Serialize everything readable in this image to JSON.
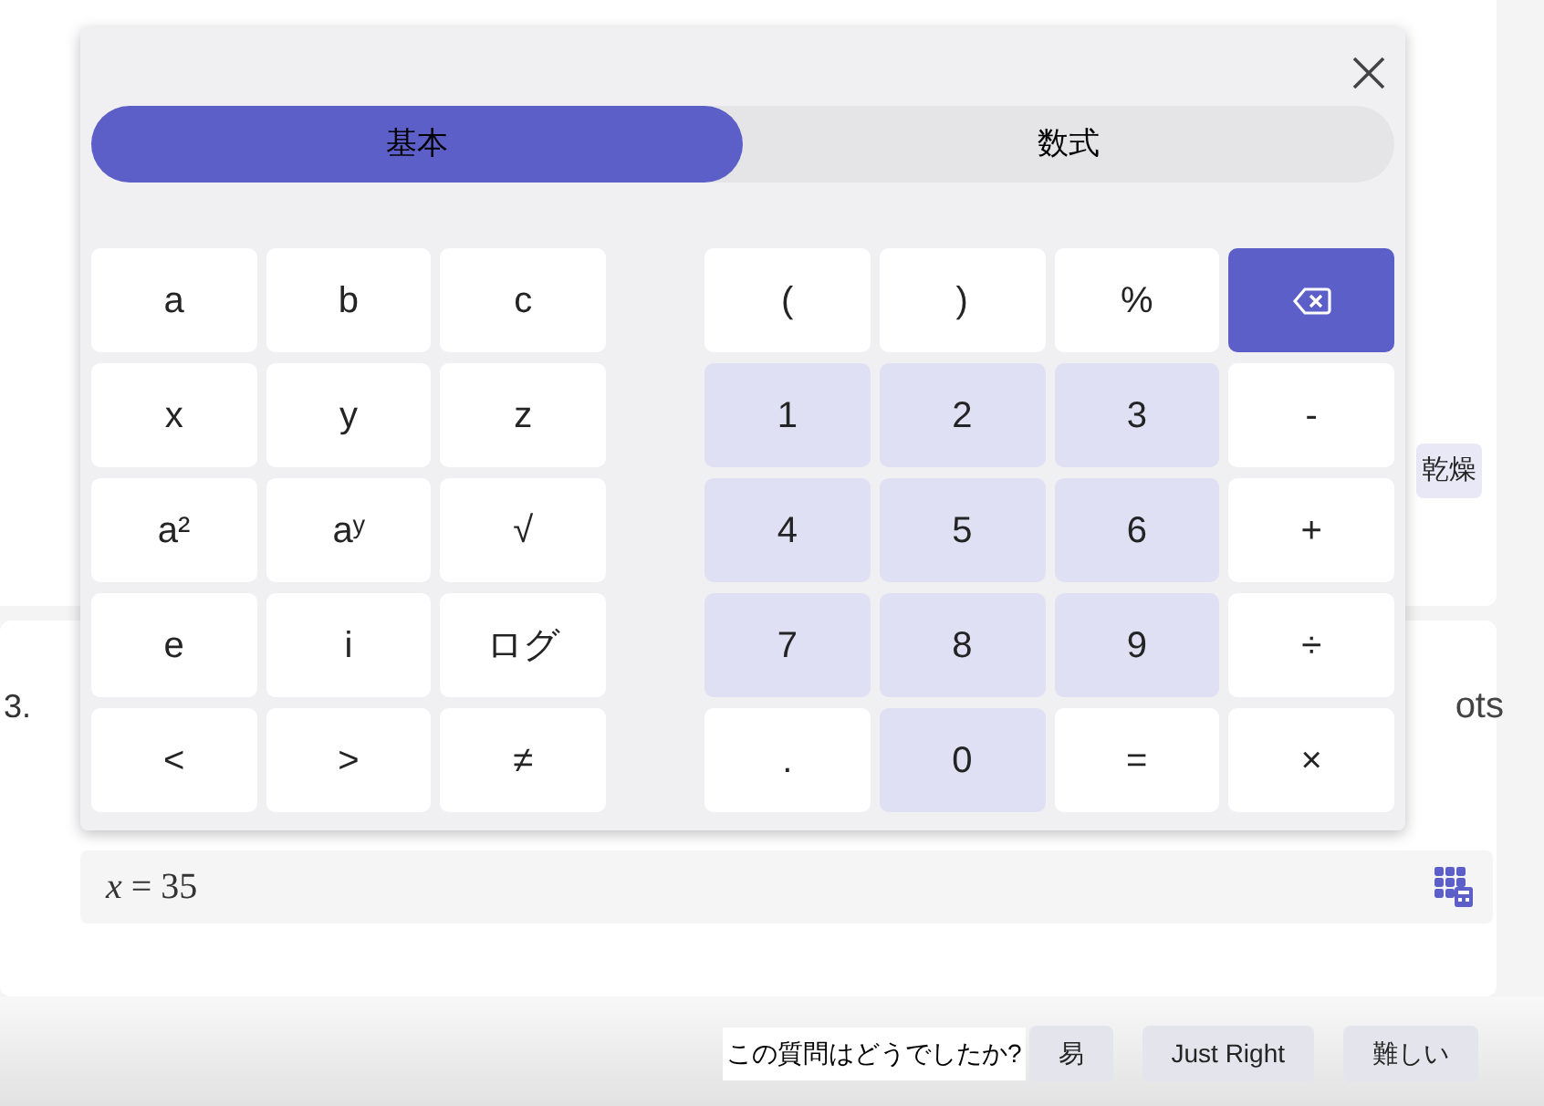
{
  "question": {
    "chip": "乾燥",
    "number": "3.",
    "partial_text": "ots",
    "answer": "*x* = 35"
  },
  "calculator": {
    "tabs": [
      {
        "label": "基本",
        "selected": true
      },
      {
        "label": "数式",
        "selected": false
      }
    ],
    "left_keys": [
      {
        "label": "a",
        "kind": "plain"
      },
      {
        "label": "b",
        "kind": "plain"
      },
      {
        "label": "c",
        "kind": "plain"
      },
      {
        "label": "x",
        "kind": "plain"
      },
      {
        "label": "y",
        "kind": "plain"
      },
      {
        "label": "z",
        "kind": "plain"
      },
      {
        "label": "a²",
        "kind": "plain"
      },
      {
        "label": "aʸ",
        "kind": "plain"
      },
      {
        "label": "√",
        "kind": "plain"
      },
      {
        "label": "e",
        "kind": "plain"
      },
      {
        "label": "i",
        "kind": "plain"
      },
      {
        "label": "ログ",
        "kind": "plain"
      },
      {
        "label": "<",
        "kind": "plain"
      },
      {
        "label": ">",
        "kind": "plain"
      },
      {
        "label": "≠",
        "kind": "plain"
      }
    ],
    "right_keys": [
      {
        "label": "(",
        "kind": "plain"
      },
      {
        "label": ")",
        "kind": "plain"
      },
      {
        "label": "%",
        "kind": "plain"
      },
      {
        "kind": "backspace"
      },
      {
        "label": "1",
        "kind": "number"
      },
      {
        "label": "2",
        "kind": "number"
      },
      {
        "label": "3",
        "kind": "number"
      },
      {
        "label": "-",
        "kind": "plain"
      },
      {
        "label": "4",
        "kind": "number"
      },
      {
        "label": "5",
        "kind": "number"
      },
      {
        "label": "6",
        "kind": "number"
      },
      {
        "label": "+",
        "kind": "plain"
      },
      {
        "label": "7",
        "kind": "number"
      },
      {
        "label": "8",
        "kind": "number"
      },
      {
        "label": "9",
        "kind": "number"
      },
      {
        "label": "÷",
        "kind": "plain"
      },
      {
        "label": ".",
        "kind": "plain"
      },
      {
        "label": "0",
        "kind": "number"
      },
      {
        "label": "=",
        "kind": "plain"
      },
      {
        "label": "×",
        "kind": "plain"
      }
    ]
  },
  "feedback": {
    "prompt": "この質問はどうでしたか?",
    "options": [
      "易",
      "Just Right",
      "難しい"
    ]
  }
}
